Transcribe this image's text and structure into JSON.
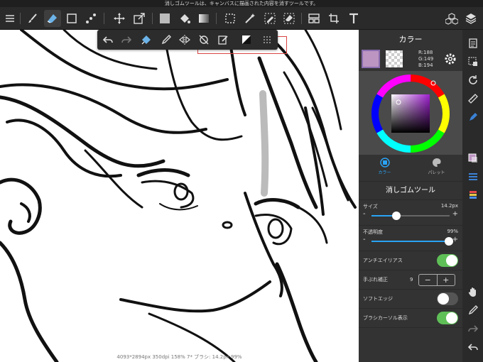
{
  "tooltip": "消しゴムツールは、キャンバスに描画された内容を消すツールです。",
  "toolbar": {
    "icons": [
      "menu-icon",
      "brush-icon",
      "eraser-icon",
      "rect-icon",
      "dots-icon",
      "move-icon",
      "transform-icon",
      "fill-color-icon",
      "bucket-icon",
      "gradient-icon",
      "select-icon",
      "magic-wand-icon",
      "select-pen-icon",
      "select-eraser-icon",
      "ruler-panel-icon",
      "crop-icon",
      "text-icon",
      "materials-icon",
      "layers-icon"
    ]
  },
  "subbar": {
    "icons": [
      "undo-icon",
      "redo-icon",
      "clear-icon",
      "eyedropper-icon",
      "flip-icon",
      "rotate-off-icon",
      "edit-icon",
      "contrast-icon",
      "grid-icon"
    ]
  },
  "statusbar": "4093*2894px 350dpi 158% 7* ブラシ: 14.2px 99%",
  "panel": {
    "title": "カラー",
    "rgb": {
      "r": "R:188",
      "g": "G:149",
      "b": "B:194"
    },
    "main_color": "#bc95c2",
    "tabs": [
      {
        "label": "カラー"
      },
      {
        "label": "パレット"
      }
    ],
    "tool_title": "消しゴムツール",
    "size": {
      "label": "サイズ",
      "value": "14.2px",
      "level": 0.32
    },
    "opacity": {
      "label": "不透明度",
      "value": "99%",
      "level": 0.99
    },
    "antialias": {
      "label": "アンチエイリアス",
      "on": true
    },
    "stabilizer": {
      "label": "手ぶれ補正",
      "value": "9",
      "minus": "−",
      "plus": "+"
    },
    "soft_edge": {
      "label": "ソフトエッジ",
      "on": false
    },
    "cursor": {
      "label": "ブラシカーソル表示",
      "on": true
    }
  },
  "minus": "-",
  "plus": "+",
  "colors": {
    "accent": "#2aa3f5",
    "toggle_on": "#5fbf57",
    "highlight_box": "#d94444"
  }
}
